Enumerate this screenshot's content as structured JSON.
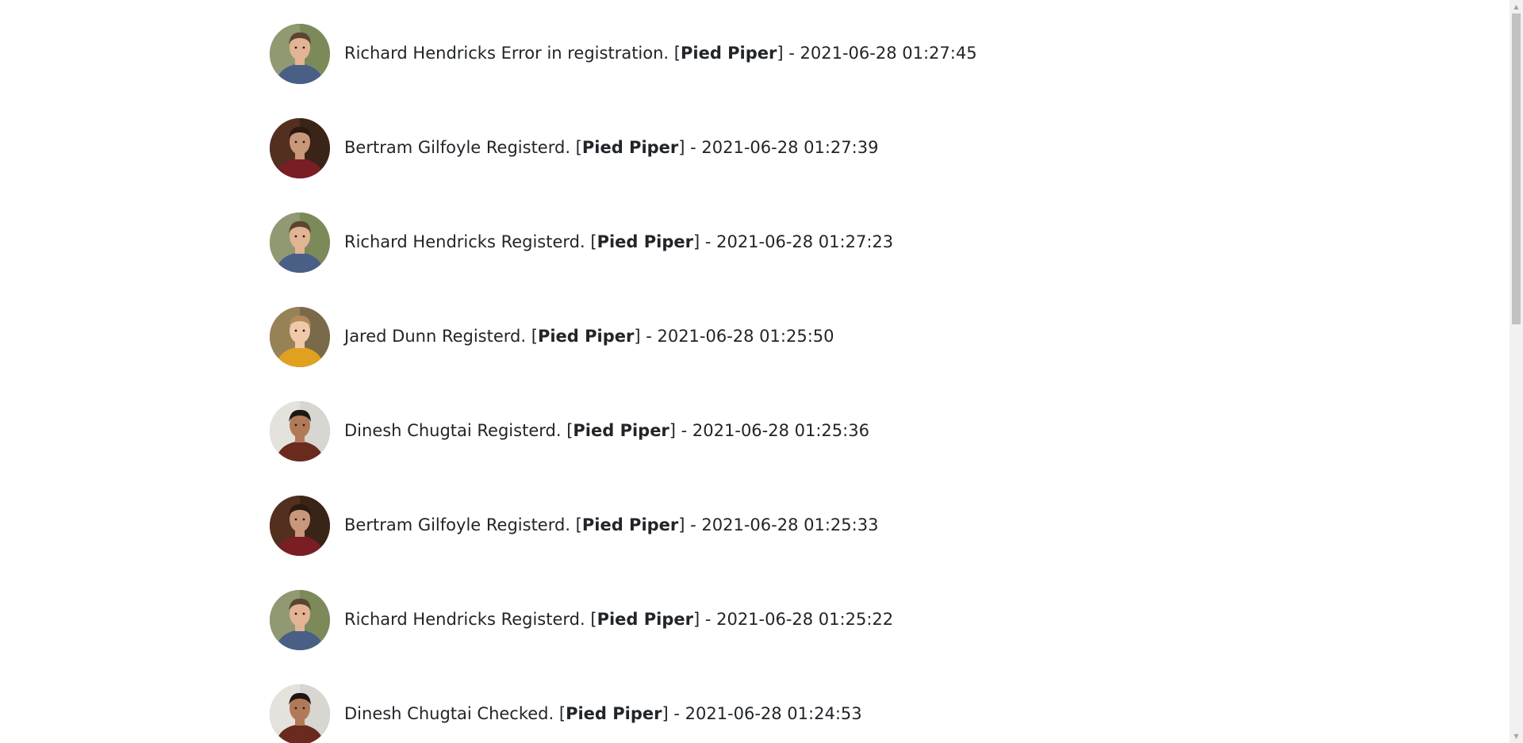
{
  "feed": {
    "entries": [
      {
        "name": "Richard Hendricks",
        "action": "Error in registration.",
        "company": "Pied Piper",
        "timestamp": "2021-06-28 01:27:45",
        "avatar": "richard"
      },
      {
        "name": "Bertram Gilfoyle",
        "action": "Registerd.",
        "company": "Pied Piper",
        "timestamp": "2021-06-28 01:27:39",
        "avatar": "gilfoyle"
      },
      {
        "name": "Richard Hendricks",
        "action": "Registerd.",
        "company": "Pied Piper",
        "timestamp": "2021-06-28 01:27:23",
        "avatar": "richard"
      },
      {
        "name": "Jared Dunn",
        "action": "Registerd.",
        "company": "Pied Piper",
        "timestamp": "2021-06-28 01:25:50",
        "avatar": "jared"
      },
      {
        "name": "Dinesh Chugtai",
        "action": "Registerd.",
        "company": "Pied Piper",
        "timestamp": "2021-06-28 01:25:36",
        "avatar": "dinesh"
      },
      {
        "name": "Bertram Gilfoyle",
        "action": "Registerd.",
        "company": "Pied Piper",
        "timestamp": "2021-06-28 01:25:33",
        "avatar": "gilfoyle"
      },
      {
        "name": "Richard Hendricks",
        "action": "Registerd.",
        "company": "Pied Piper",
        "timestamp": "2021-06-28 01:25:22",
        "avatar": "richard"
      },
      {
        "name": "Dinesh Chugtai",
        "action": "Checked.",
        "company": "Pied Piper",
        "timestamp": "2021-06-28 01:24:53",
        "avatar": "dinesh"
      }
    ]
  },
  "scrollbar": {
    "position_fraction": 0.0
  }
}
